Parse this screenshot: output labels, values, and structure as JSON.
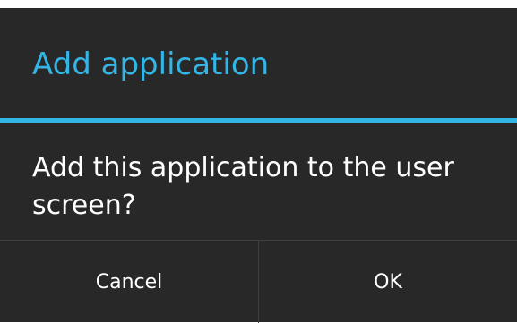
{
  "dialog": {
    "title": "Add application",
    "message": "Add this application to the user screen?",
    "buttons": {
      "cancel_label": "Cancel",
      "ok_label": "OK"
    }
  },
  "colors": {
    "accent": "#33b5e5",
    "dialog_background": "#282828",
    "text": "#ffffff",
    "divider": "#3f3f3f"
  }
}
